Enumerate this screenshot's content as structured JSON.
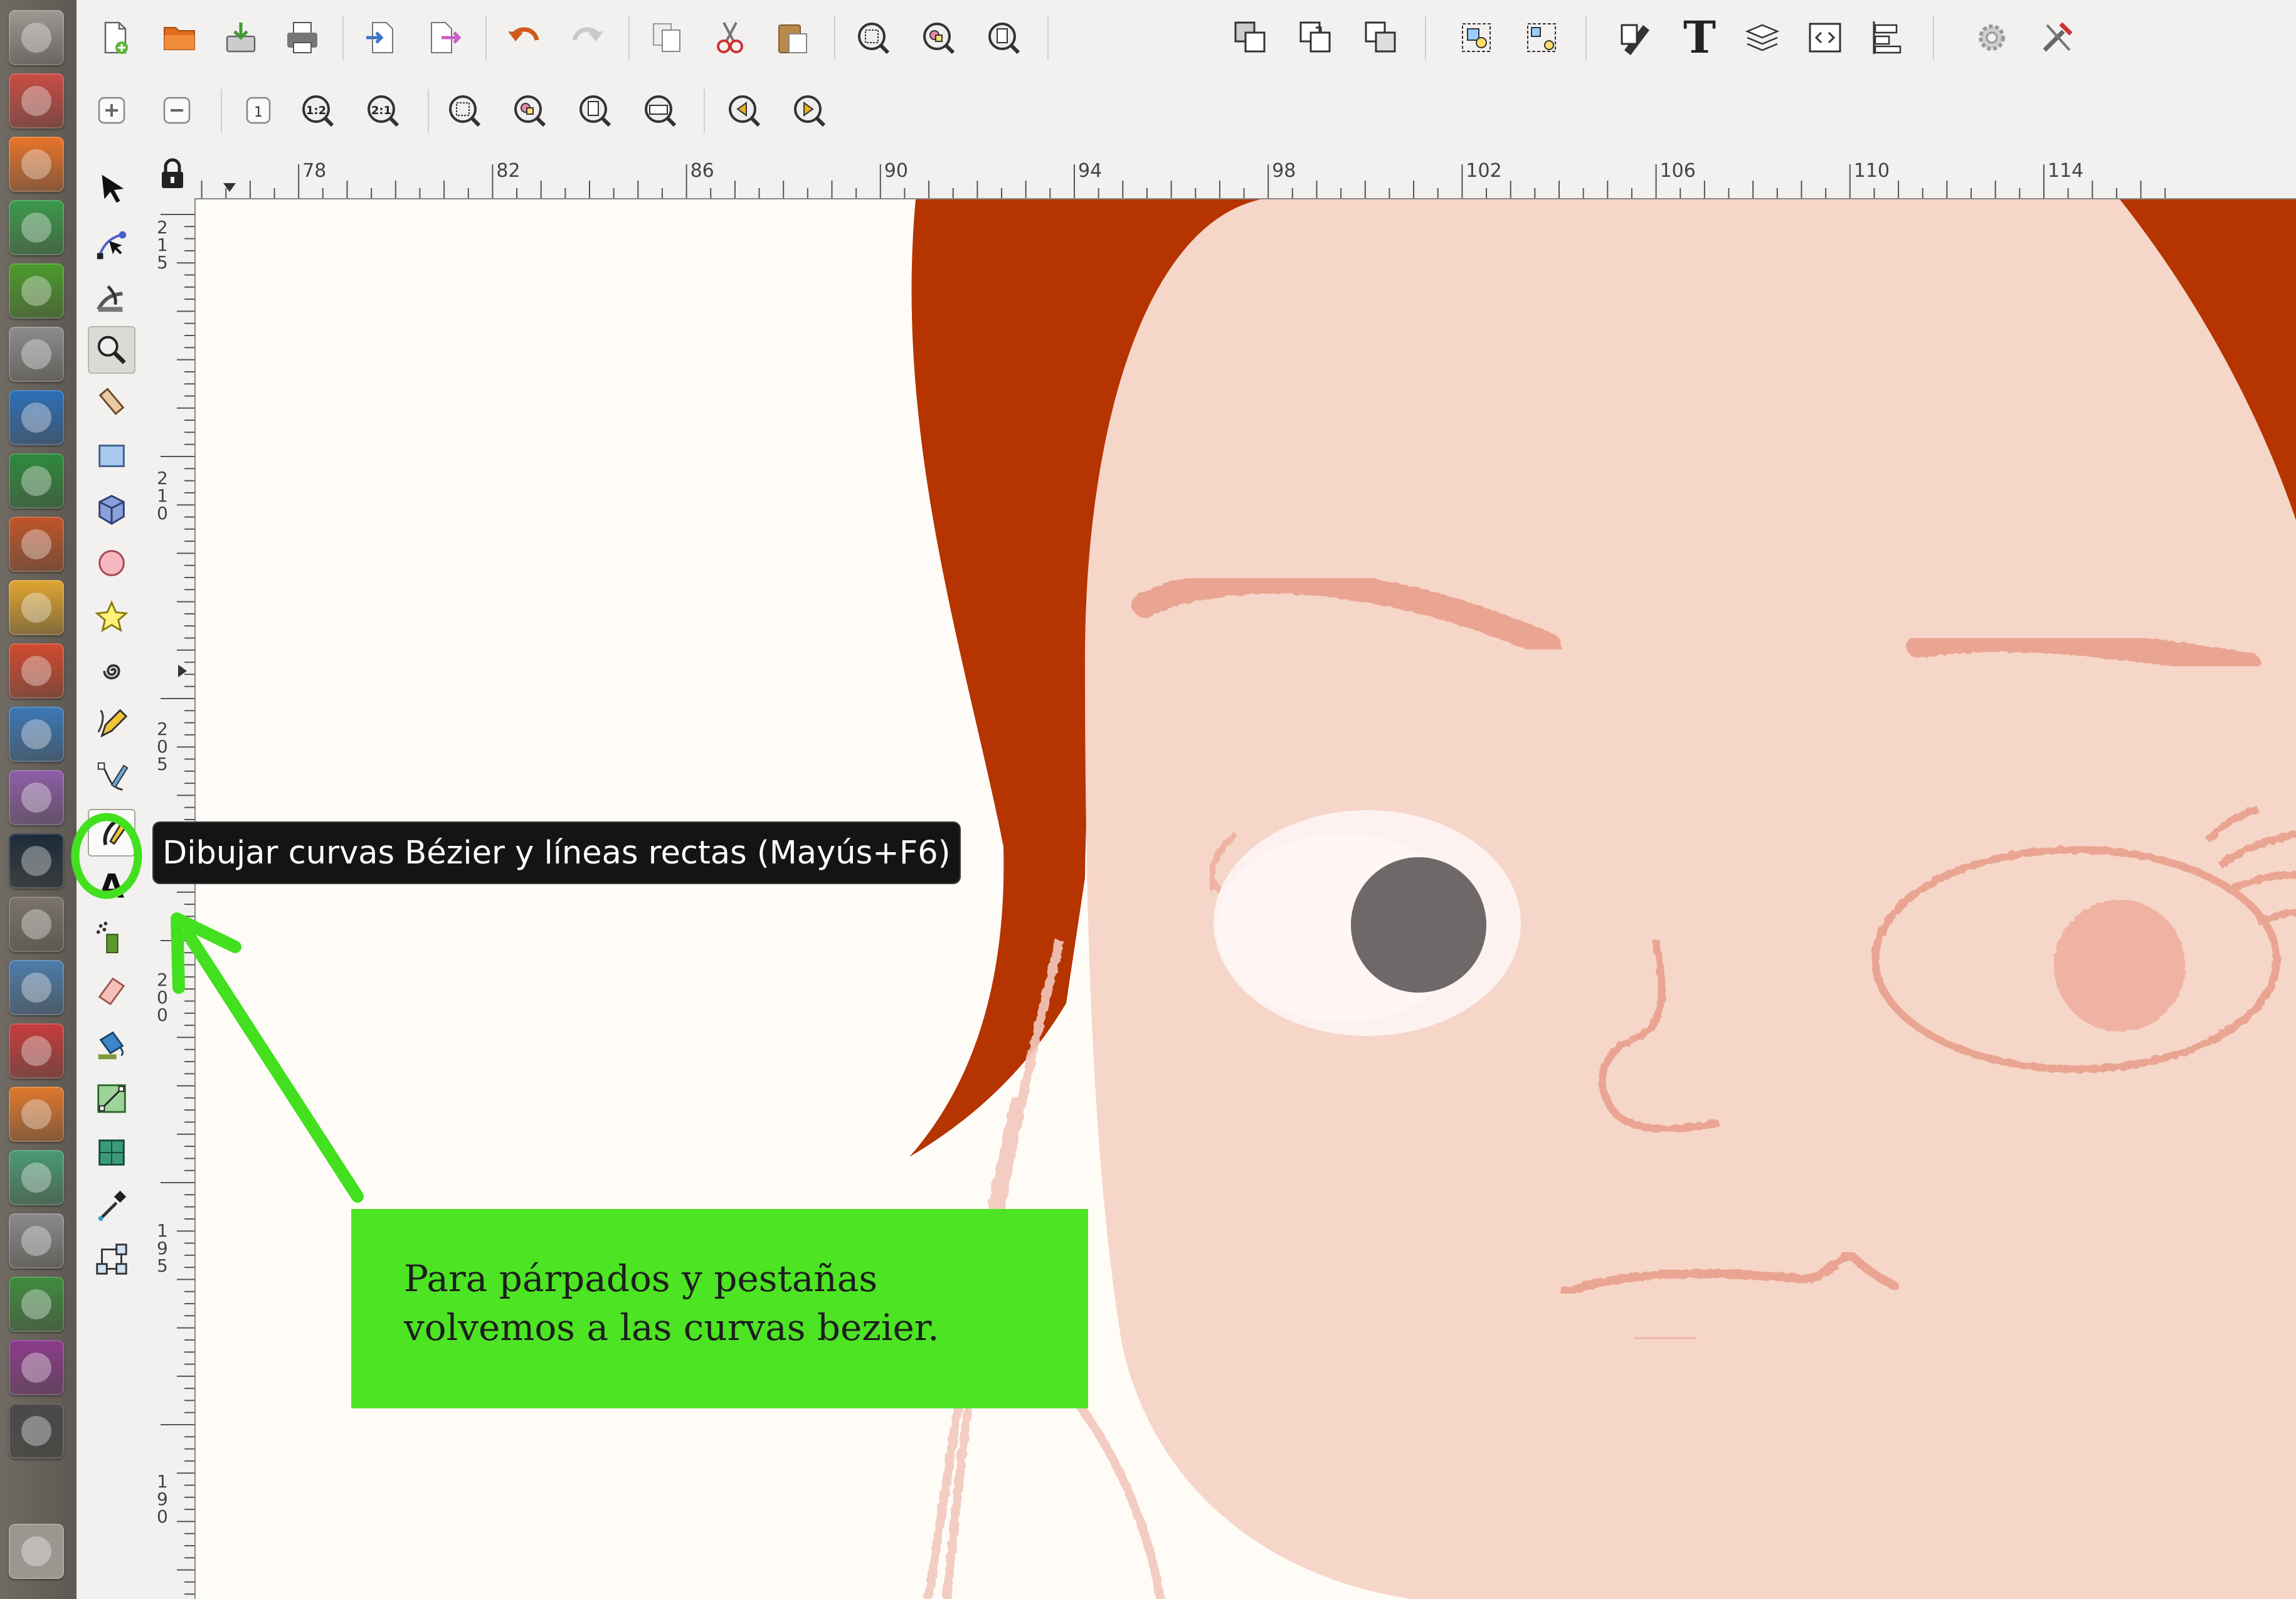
{
  "window": {
    "app": "Inkscape",
    "locale": "es"
  },
  "launcher": {
    "items": [
      {
        "name": "dash-home",
        "color": "#9c9892"
      },
      {
        "name": "files",
        "color": "#c94c44"
      },
      {
        "name": "firefox",
        "color": "#e8742a"
      },
      {
        "name": "chrome",
        "color": "#3a9a4a"
      },
      {
        "name": "software-center",
        "color": "#4b9c2b"
      },
      {
        "name": "calculator",
        "color": "#8c8c8c"
      },
      {
        "name": "writer",
        "color": "#2d6fb8"
      },
      {
        "name": "calc",
        "color": "#2e8a3c"
      },
      {
        "name": "impress",
        "color": "#c1552a"
      },
      {
        "name": "draw",
        "color": "#e0a531"
      },
      {
        "name": "color-app",
        "color": "#d34a2f"
      },
      {
        "name": "pencil-app",
        "color": "#3b78b8"
      },
      {
        "name": "ball-app",
        "color": "#8e5ea8"
      },
      {
        "name": "inkscape",
        "color": "#1c2b3a"
      },
      {
        "name": "gimp",
        "color": "#7b7469"
      },
      {
        "name": "text-editor",
        "color": "#4d7cab"
      },
      {
        "name": "settings-app",
        "color": "#c63c3c"
      },
      {
        "name": "blender",
        "color": "#e0782c"
      },
      {
        "name": "geometry-app",
        "color": "#4a9a74"
      },
      {
        "name": "camera-app",
        "color": "#8a8a8a"
      },
      {
        "name": "updater",
        "color": "#3e8c3e"
      },
      {
        "name": "workspaces",
        "color": "#8b3b8b"
      },
      {
        "name": "terminal",
        "color": "#4a4a4a"
      },
      {
        "name": "trash",
        "color": "#b8b8b8"
      }
    ]
  },
  "toolbar": {
    "commands": [
      "new",
      "open",
      "save",
      "print",
      "import",
      "export",
      "undo",
      "redo",
      "duplicate",
      "cut",
      "paste",
      "zoom-selection",
      "zoom-drawing",
      "zoom-page",
      "duplicate-object",
      "clone",
      "unlink-clone",
      "group",
      "ungroup",
      "fill-stroke",
      "text-font",
      "layers",
      "xml-editor",
      "align",
      "preferences",
      "document-properties"
    ],
    "text_tool_glyph": "T"
  },
  "snapbar": {
    "commands": [
      "zoom-in",
      "zoom-out",
      "zoom-1-1",
      "zoom-1-2",
      "zoom-2-1",
      "zoom-selection",
      "zoom-drawing",
      "zoom-page",
      "zoom-page-width",
      "zoom-previous",
      "zoom-next"
    ],
    "labels": {
      "zoom_1_1": "1",
      "zoom_1_2": "1:2",
      "zoom_2_1": "2:1"
    }
  },
  "tools": {
    "items": [
      "selector",
      "node",
      "tweak",
      "zoom",
      "measure",
      "rectangle",
      "3d-box",
      "ellipse",
      "star",
      "spiral",
      "pencil",
      "pen",
      "calligraphy",
      "text",
      "spray",
      "eraser",
      "paint-bucket",
      "gradient",
      "mesh",
      "dropper",
      "connector"
    ],
    "active": "zoom",
    "hovered": "calligraphy"
  },
  "ruler": {
    "horizontal_labels": [
      "78",
      "82",
      "86",
      "90",
      "94",
      "98",
      "102",
      "106",
      "110",
      "114"
    ],
    "vertical_labels": [
      "215",
      "210",
      "205",
      "200",
      "195",
      "190"
    ]
  },
  "tooltip": {
    "text": "Dibujar curvas Bézier y líneas rectas (Mayús+F6)"
  },
  "annotation": {
    "line1": "Para párpados y pestañas",
    "line2": "volvemos a las curvas bezier.",
    "box_color": "#4ce423"
  },
  "colors": {
    "hair": "#b53400",
    "skin": "#f6d6c8",
    "stroke_pink": "#e9a493",
    "eye_white": "#fdf4f2",
    "pupil": "#6e6968",
    "highlight_green": "#43e01f"
  }
}
